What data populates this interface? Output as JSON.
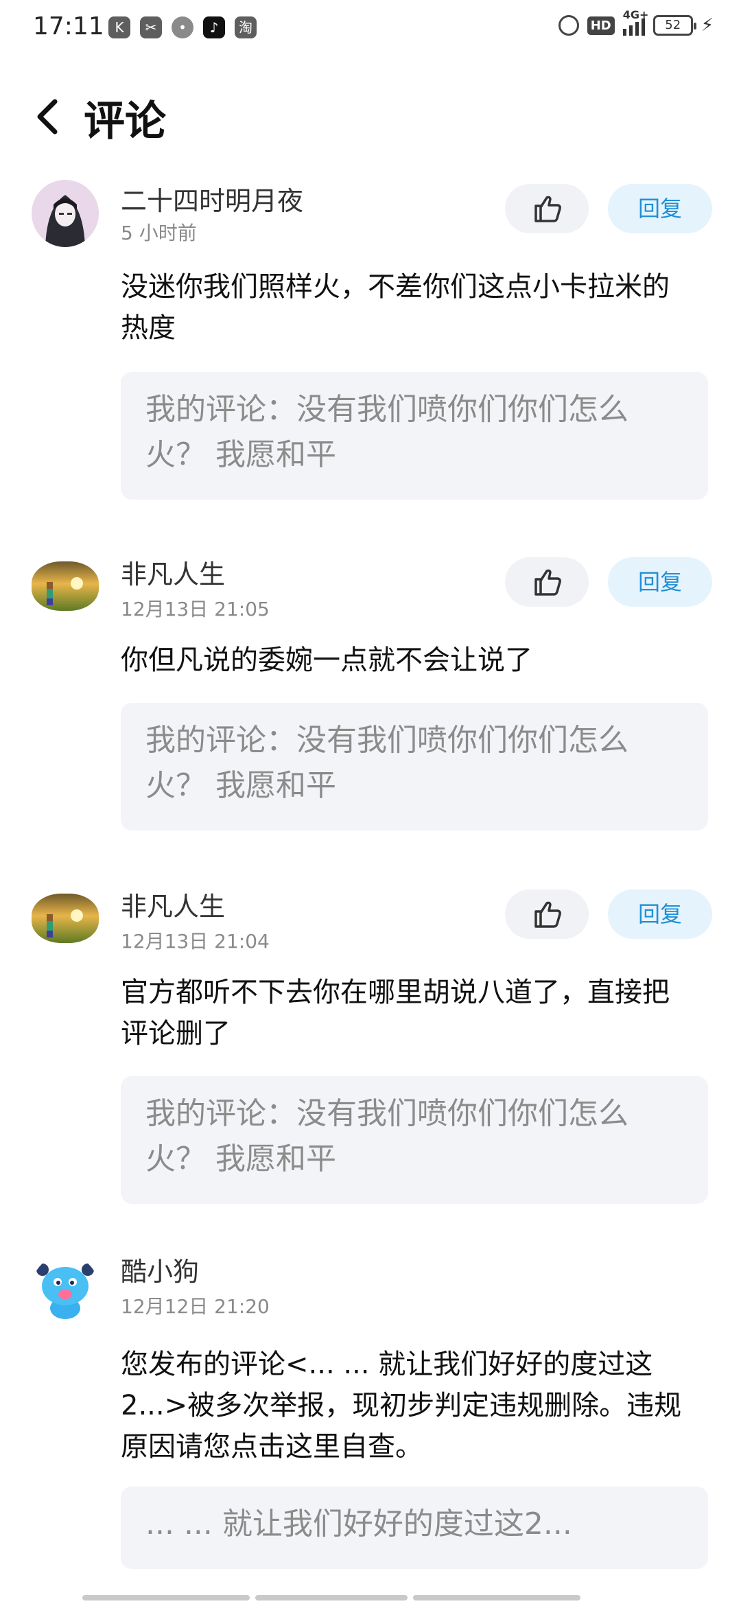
{
  "status_bar": {
    "time": "17:11",
    "left_icons": [
      "K",
      "✂",
      "•",
      "♪",
      "淘"
    ],
    "hd": "HD",
    "network": "4G+",
    "battery": "52"
  },
  "header": {
    "title": "评论"
  },
  "comments": [
    {
      "username": "二十四时明月夜",
      "time": "5 小时前",
      "text": "没迷你我们照样火，不差你们这点小卡拉米的热度",
      "quote": "我的评论：没有我们喷你们你们怎么火？ 我愿和平",
      "reply_label": "回复"
    },
    {
      "username": "非凡人生",
      "time": "12月13日 21:05",
      "text": "你但凡说的委婉一点就不会让说了",
      "quote": "我的评论：没有我们喷你们你们怎么火？ 我愿和平",
      "reply_label": "回复"
    },
    {
      "username": "非凡人生",
      "time": "12月13日 21:04",
      "text": "官方都听不下去你在哪里胡说八道了，直接把评论删了",
      "quote": "我的评论：没有我们喷你们你们怎么火？ 我愿和平",
      "reply_label": "回复"
    },
    {
      "username": "酷小狗",
      "time": "12月12日 21:20",
      "text": "您发布的评论<... ...  就让我们好好的度过这2...>被多次举报，现初步判定违规删除。违规原因请您点击这里自查。",
      "quote": "... ...  就让我们好好的度过这2..."
    }
  ]
}
